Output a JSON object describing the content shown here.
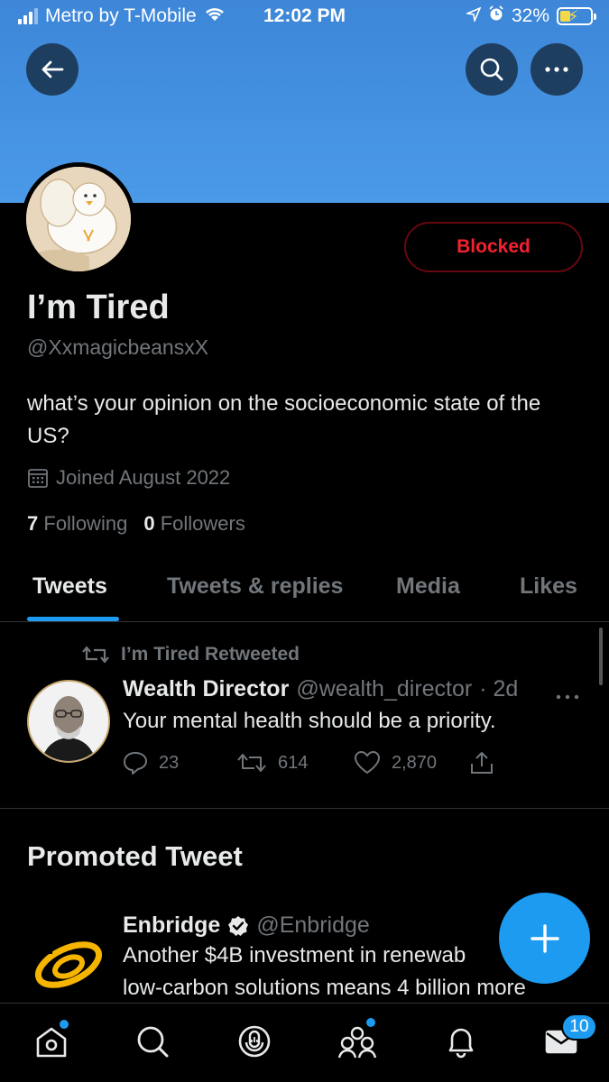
{
  "status_bar": {
    "carrier": "Metro by T-Mobile",
    "time": "12:02 PM",
    "battery": "32%"
  },
  "profile": {
    "display_name": "I’m Tired",
    "handle": "@XxmagicbeansxX",
    "bio": "what’s your opinion on the socioeconomic state of the US?",
    "joined": "Joined August 2022",
    "following_count": "7",
    "following_label": "Following",
    "followers_count": "0",
    "followers_label": "Followers",
    "blocked_label": "Blocked"
  },
  "tabs": [
    {
      "label": "Tweets",
      "active": true
    },
    {
      "label": "Tweets & replies",
      "active": false
    },
    {
      "label": "Media",
      "active": false
    },
    {
      "label": "Likes",
      "active": false
    }
  ],
  "tweet": {
    "retweet_label": "I’m Tired Retweeted",
    "author_name": "Wealth Director",
    "author_handle": "@wealth_director",
    "time": "· 2d",
    "text": "Your mental health should be a priority.",
    "replies": "23",
    "retweets": "614",
    "likes": "2,870"
  },
  "promoted": {
    "section_title": "Promoted Tweet",
    "author_name": "Enbridge",
    "author_handle": "@Enbridge",
    "line1": "Another $4B investment in renewab",
    "line2": "low-carbon solutions means 4 billion more"
  },
  "bottom_nav": {
    "messages_badge": "10"
  },
  "colors": {
    "accent": "#1d9bf0",
    "banner": "#4a9ae8",
    "blocked_red": "#f4212e",
    "muted_text": "#71767b"
  },
  "icons": [
    "back-arrow-icon",
    "search-icon",
    "more-icon",
    "calendar-icon",
    "retweet-icon",
    "reply-icon",
    "like-icon",
    "share-icon",
    "verified-icon",
    "compose-icon",
    "home-icon",
    "explore-icon",
    "spaces-icon",
    "communities-icon",
    "notifications-icon",
    "messages-icon"
  ]
}
